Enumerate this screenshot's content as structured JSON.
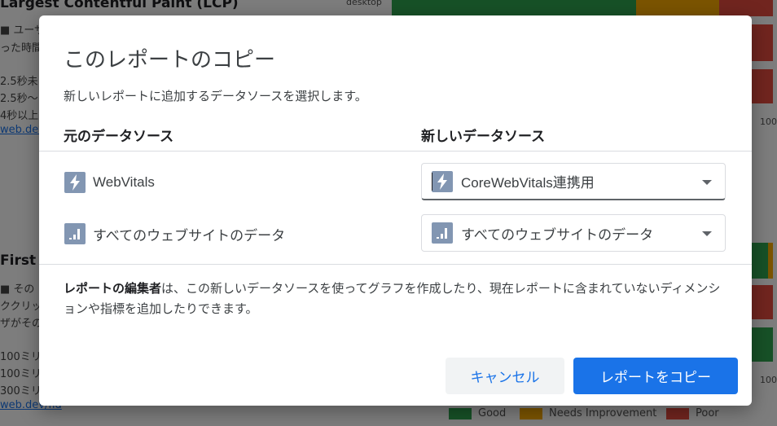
{
  "background": {
    "section1_title": "Largest Contentful Paint (LCP)",
    "section1_lines": [
      "■ ユーザ",
      "った時間",
      "2.5秒未",
      "2.5秒〜",
      "4秒以上"
    ],
    "section1_link": "web.dev/",
    "section2_title": "First I",
    "section2_lines": [
      "■ その",
      "ククリッ",
      "ザがその",
      "100ミリ",
      "100ミリ",
      "300ミリ"
    ],
    "section2_link": "web.dev/fid",
    "device_label": "desktop",
    "axis_tick": "100",
    "legend": [
      {
        "label": "Good",
        "color": "#2fa24e"
      },
      {
        "label": "Needs Improvement",
        "color": "#f6a800"
      },
      {
        "label": "Poor",
        "color": "#e34b3f"
      }
    ]
  },
  "dialog": {
    "title": "このレポートのコピー",
    "description": "新しいレポートに追加するデータソースを選択します。",
    "col_original": "元のデータソース",
    "col_new": "新しいデータソース",
    "rows": [
      {
        "source": "WebVitals",
        "source_icon": "lightning-icon",
        "target": "CoreWebVitals連携用",
        "target_icon": "lightning-icon"
      },
      {
        "source": "すべてのウェブサイトのデータ",
        "source_icon": "bar-chart-icon",
        "target": "すべてのウェブサイトのデータ",
        "target_icon": "bar-chart-icon"
      }
    ],
    "note_bold": "レポートの編集者",
    "note_rest": "は、この新しいデータソースを使ってグラフを作成したり、現在レポートに含まれていないディメンションや指標を追加したりできます。",
    "cancel_label": "キャンセル",
    "copy_label": "レポートをコピー"
  },
  "colors": {
    "accent": "#1a73e8",
    "icon_bg": "#8296b2"
  }
}
